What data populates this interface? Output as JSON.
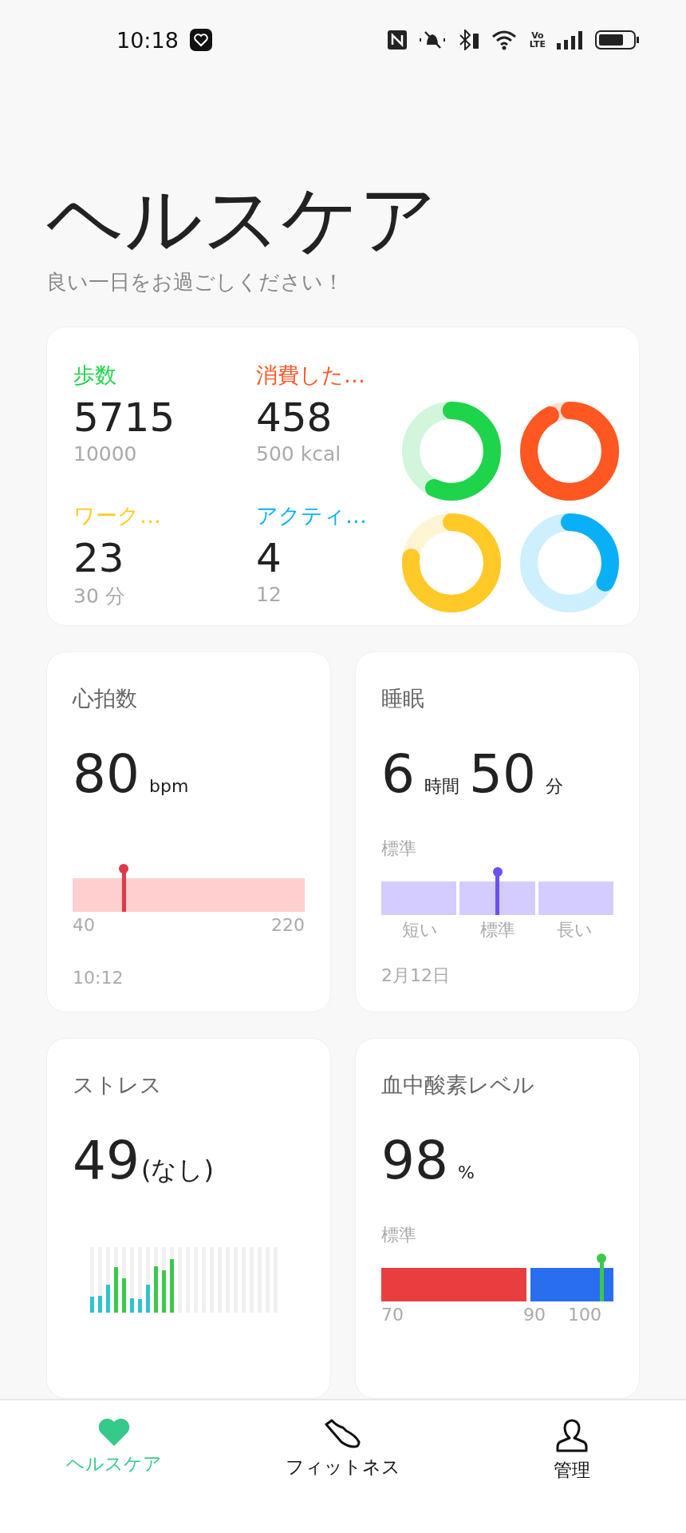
{
  "status_bar": {
    "time": "10:18",
    "network_top": "Vo",
    "network_bottom": "LTE"
  },
  "header": {
    "title": "ヘルスケア",
    "subtitle": "良い一日をお過ごしください！"
  },
  "summary": {
    "metrics": [
      {
        "label": "歩数",
        "value": "5715",
        "goal": "10000",
        "color": "#1ed44a",
        "level": 0.57
      },
      {
        "label": "消費した…",
        "value": "458",
        "goal": "500 kcal",
        "color": "#ff5722",
        "level": 0.92
      },
      {
        "label": "ワーク…",
        "value": "23",
        "goal": "30 分",
        "color": "#ffc928",
        "level": 0.77
      },
      {
        "label": "アクティ…",
        "value": "4",
        "goal": "12",
        "color": "#0ab0f5",
        "level": 0.33
      }
    ]
  },
  "heart_rate": {
    "title": "心拍数",
    "value": "80",
    "unit": "bpm",
    "min": "40",
    "max": "220",
    "time": "10:12"
  },
  "sleep": {
    "title": "睡眠",
    "hours": "6",
    "hours_unit": "時間",
    "minutes": "50",
    "minutes_unit": "分",
    "status": "標準",
    "segments": [
      "短い",
      "標準",
      "長い"
    ],
    "date": "2月12日"
  },
  "stress": {
    "title": "ストレス",
    "value": "49",
    "status": "(なし)"
  },
  "blood_oxygen": {
    "title": "血中酸素レベル",
    "value": "98",
    "unit": "%",
    "status": "標準",
    "ticks": [
      "70",
      "90",
      "100"
    ]
  },
  "nav": [
    {
      "label": "ヘルスケア",
      "kind": "heart",
      "selected": true
    },
    {
      "label": "フィットネス",
      "kind": "shoe",
      "selected": false
    },
    {
      "label": "管理",
      "kind": "person",
      "selected": false
    }
  ]
}
